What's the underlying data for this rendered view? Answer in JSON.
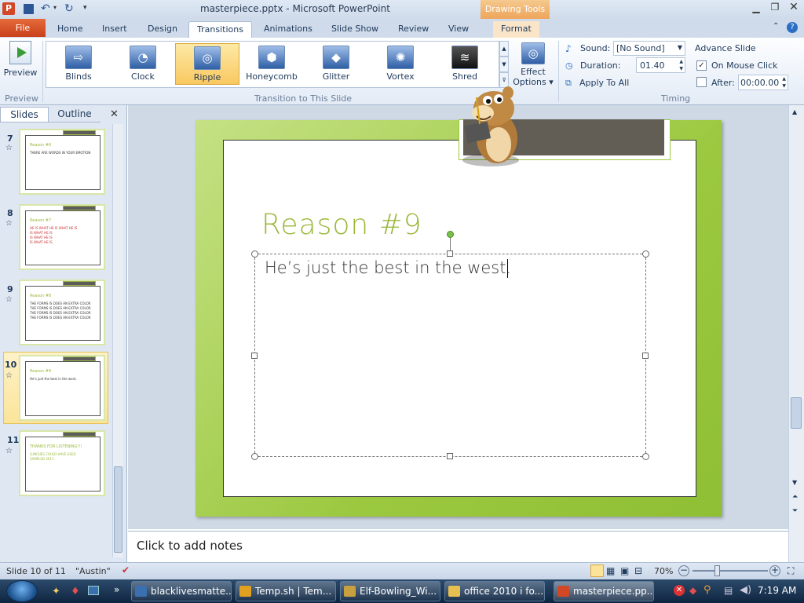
{
  "titlebar": {
    "title": "masterpiece.pptx - Microsoft PowerPoint",
    "contextual_tab": "Drawing Tools"
  },
  "tabs": [
    "File",
    "Home",
    "Insert",
    "Design",
    "Transitions",
    "Animations",
    "Slide Show",
    "Review",
    "View",
    "Format"
  ],
  "active_tab": "Transitions",
  "ribbon": {
    "preview_label": "Preview",
    "preview_group": "Preview",
    "transitions": [
      "Blinds",
      "Clock",
      "Ripple",
      "Honeycomb",
      "Glitter",
      "Vortex",
      "Shred"
    ],
    "selected_transition": "Ripple",
    "effect_options": [
      "Effect",
      "Options"
    ],
    "transition_group": "Transition to This Slide",
    "sound_label": "Sound:",
    "sound_value": "[No Sound]",
    "duration_label": "Duration:",
    "duration_value": "01.40",
    "apply_all": "Apply To All",
    "advance_label": "Advance Slide",
    "on_mouse_click": "On Mouse Click",
    "after_label": "After:",
    "after_value": "00:00.00",
    "timing_group": "Timing"
  },
  "pane_tabs": {
    "slides": "Slides",
    "outline": "Outline"
  },
  "thumbnails": [
    {
      "num": "7",
      "title": "Reason #6",
      "text": "THERE ARE WORDS IN YOUR EMOTION"
    },
    {
      "num": "8",
      "title": "Reason #7",
      "text": "HE IS WHAT HE IS WHAT HE IS\nIS WHAT HE IS\nIS WHAT HE IS\nIS WHAT HE IS"
    },
    {
      "num": "9",
      "title": "Reason #8",
      "text": "THE FORMS IS DOES AN EXTRA COLOR\nTHE FORMS IS DOES AN EXTRA COLOR\nTHE FORMS IS DOES AN EXTRA COLOR\nTHE FORMS IS DOES AN EXTRA COLOR"
    },
    {
      "num": "10",
      "title": "Reason #9",
      "text": "He's just the best in the west."
    },
    {
      "num": "11",
      "title": "THANKS FOR LISTENING!!!",
      "text": "LUNCHES COULD HAVE USED\nSAMPLED 2011"
    }
  ],
  "slide": {
    "title": "Reason #9",
    "body": "He’s just the best in the west."
  },
  "notes_placeholder": "Click to add notes",
  "statusbar": {
    "slide_info": "Slide 10 of 11",
    "theme": "\"Austin\"",
    "zoom": "70%"
  },
  "taskbar": {
    "items": [
      "blacklivesmatte...",
      "Temp.sh | Tem...",
      "Elf-Bowling_Wi...",
      "office 2010 i fo...",
      "masterpiece.pp..."
    ],
    "time": "7:19 AM"
  }
}
